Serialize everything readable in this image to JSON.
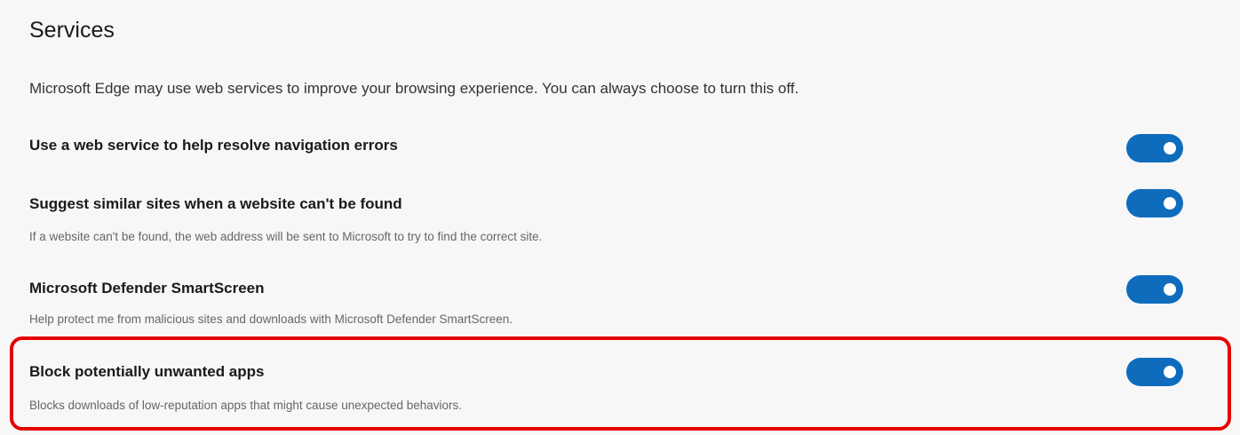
{
  "section": {
    "title": "Services",
    "description": "Microsoft Edge may use web services to improve your browsing experience. You can always choose to turn this off."
  },
  "settings": [
    {
      "title": "Use a web service to help resolve navigation errors",
      "subtitle": "",
      "enabled": true
    },
    {
      "title": "Suggest similar sites when a website can't be found",
      "subtitle": "If a website can't be found, the web address will be sent to Microsoft to try to find the correct site.",
      "enabled": true
    },
    {
      "title": "Microsoft Defender SmartScreen",
      "subtitle": "Help protect me from malicious sites and downloads with Microsoft Defender SmartScreen.",
      "enabled": true
    },
    {
      "title": "Block potentially unwanted apps",
      "subtitle": "Blocks downloads of low-reputation apps that might cause unexpected behaviors.",
      "enabled": true
    }
  ],
  "colors": {
    "toggle_on": "#0f6cbd",
    "highlight": "#e60000"
  }
}
